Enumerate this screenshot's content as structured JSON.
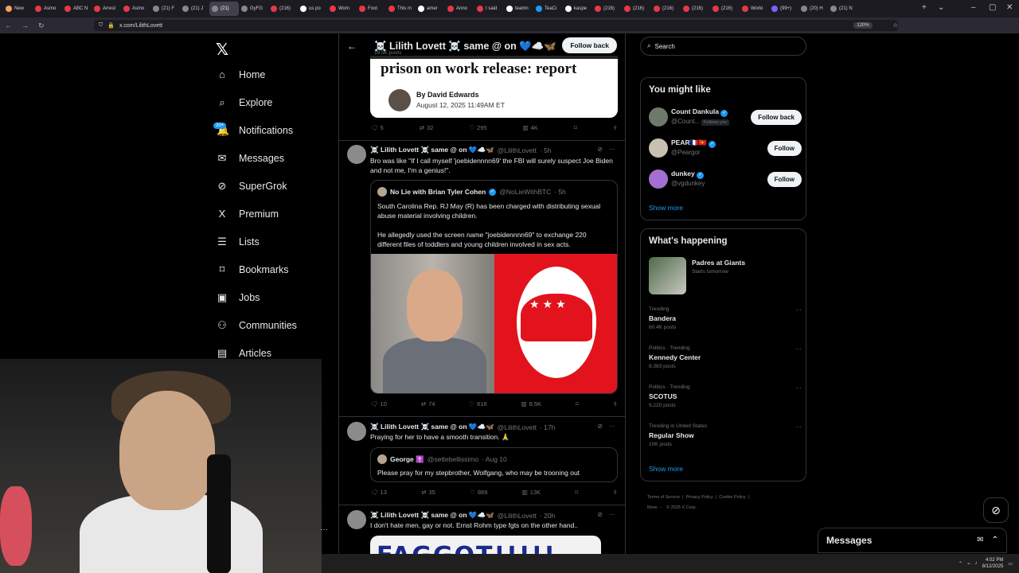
{
  "browser": {
    "tabs": [
      {
        "label": "New",
        "color": "#f4a261"
      },
      {
        "label": "Asmo",
        "color": "#e63946"
      },
      {
        "label": "ABC N",
        "color": "#e63946"
      },
      {
        "label": "Arrest",
        "color": "#e63946"
      },
      {
        "label": "Asmo",
        "color": "#e63946"
      },
      {
        "label": "(21) F",
        "color": "#888888"
      },
      {
        "label": "(21) J",
        "color": "#888888"
      },
      {
        "label": "(21)",
        "color": "#888888"
      },
      {
        "label": "GyFG",
        "color": "#888888"
      },
      {
        "label": "(216)",
        "color": "#e63946"
      },
      {
        "label": "us po",
        "color": "#ffffff"
      },
      {
        "label": "Wom",
        "color": "#e63946"
      },
      {
        "label": "Foot",
        "color": "#e63946"
      },
      {
        "label": "This m",
        "color": "#e63946"
      },
      {
        "label": "amer",
        "color": "#ffffff"
      },
      {
        "label": "Anno",
        "color": "#e63946"
      },
      {
        "label": "I said",
        "color": "#e63946"
      },
      {
        "label": "teamn",
        "color": "#ffffff"
      },
      {
        "label": "TeaCi",
        "color": "#1d9bf0"
      },
      {
        "label": "kaspe",
        "color": "#ffffff"
      },
      {
        "label": "(216)",
        "color": "#e63946"
      },
      {
        "label": "(216)",
        "color": "#e63946"
      },
      {
        "label": "(216)",
        "color": "#e63946"
      },
      {
        "label": "(216)",
        "color": "#e63946"
      },
      {
        "label": "(216)",
        "color": "#e63946"
      },
      {
        "label": "Worki",
        "color": "#e63946"
      },
      {
        "label": "(99+)",
        "color": "#7b61ff"
      },
      {
        "label": "(20) H",
        "color": "#888888"
      },
      {
        "label": "(21) N",
        "color": "#888888"
      }
    ],
    "active_tab_index": 7,
    "url": "x.com/LilithLovett",
    "zoom": "120%"
  },
  "nav": {
    "items": [
      {
        "label": "Home",
        "icon": "home-icon",
        "glyph": "⌂"
      },
      {
        "label": "Explore",
        "icon": "search-icon",
        "glyph": "⌕"
      },
      {
        "label": "Notifications",
        "icon": "bell-icon",
        "glyph": "🔔"
      },
      {
        "label": "Messages",
        "icon": "mail-icon",
        "glyph": "✉"
      },
      {
        "label": "SuperGrok",
        "icon": "grok-icon",
        "glyph": "⊘"
      },
      {
        "label": "Premium",
        "icon": "x-icon",
        "glyph": "X"
      },
      {
        "label": "Lists",
        "icon": "list-icon",
        "glyph": "☰"
      },
      {
        "label": "Bookmarks",
        "icon": "bookmark-icon",
        "glyph": "⌑"
      },
      {
        "label": "Jobs",
        "icon": "briefcase-icon",
        "glyph": "▣"
      },
      {
        "label": "Communities",
        "icon": "people-icon",
        "glyph": "⚇"
      },
      {
        "label": "Articles",
        "icon": "article-icon",
        "glyph": "▤"
      }
    ],
    "notifications_badge": "20+"
  },
  "profile": {
    "name": "☠️ Lilith Lovett ☠️ same @ on 💙☁️🦋",
    "posts": "19.5K posts",
    "follow_back": "Follow back"
  },
  "article_card": {
    "headline": "prison on work release: report",
    "byline": "By David Edwards",
    "date": "August 12, 2025 11:49AM ET"
  },
  "post0_actions": {
    "replies": "5",
    "reposts": "32",
    "likes": "295",
    "views": "4K"
  },
  "post1": {
    "name": "☠️ Lilith Lovett ☠️ same @ on 💙☁️🦋",
    "handle": "@LilithLovett",
    "time": "· 5h",
    "text": "Bro was like \"If I call myself 'joebidennnn69' the FBI will surely suspect Joe Biden and not me, I'm a genius!\".",
    "quote": {
      "name": "No Lie with Brian Tyler Cohen",
      "handle": "@NoLieWithBTC",
      "time": "· 5h",
      "text1": "South Carolina Rep. RJ May (R) has been charged with distributing sexual abuse material involving children.",
      "text2": "He allegedly used the screen name \"joebidennnn69\" to exchange 220 different files of toddlers and young children involved in sex acts."
    },
    "actions": {
      "replies": "10",
      "reposts": "74",
      "likes": "618",
      "views": "8.5K"
    }
  },
  "post2": {
    "name": "☠️ Lilith Lovett ☠️ same @ on 💙☁️🦋",
    "handle": "@LilithLovett",
    "time": "· 17h",
    "text": "Praying for her to have a smooth transition. 🙏",
    "quote": {
      "name": "George ✝️",
      "handle": "@settebellissimo",
      "time": "· Aug 10",
      "text": "Please pray for my stepbrother, Wolfgang, who may be trooning out"
    },
    "actions": {
      "replies": "13",
      "reposts": "35",
      "likes": "889",
      "views": "13K"
    }
  },
  "post3": {
    "name": "☠️ Lilith Lovett ☠️ same @ on 💙☁️🦋",
    "handle": "@LilithLovett",
    "time": "· 20h",
    "text": "I don't hate men, gay or not. Ernst Rohm type fgts on the other hand..",
    "image_text": "FAGGOT!!!!!"
  },
  "search": {
    "placeholder": "Search"
  },
  "suggestions": {
    "title": "You might like",
    "users": [
      {
        "name": "Count Dankula",
        "handle": "@Count...",
        "follows_you": "Follows you",
        "button": "Follow back"
      },
      {
        "name": "PEAR🇫🇷🇻🇳",
        "handle": "@Peargor",
        "follows_you": "",
        "button": "Follow"
      },
      {
        "name": "dunkey",
        "handle": "@vgdunkey",
        "follows_you": "",
        "button": "Follow"
      }
    ],
    "show_more": "Show more"
  },
  "happening": {
    "title": "What's happening",
    "featured": {
      "name": "Padres at Giants",
      "sub": "Starts tomorrow"
    },
    "trends": [
      {
        "category": "Trending",
        "name": "Bandera",
        "posts": "60.4K posts"
      },
      {
        "category": "Politics · Trending",
        "name": "Kennedy Center",
        "posts": "8,383 posts"
      },
      {
        "category": "Politics · Trending",
        "name": "SCOTUS",
        "posts": "9,220 posts"
      },
      {
        "category": "Trending in United States",
        "name": "Regular Show",
        "posts": "10K posts"
      }
    ],
    "show_more": "Show more"
  },
  "footer": {
    "terms": "Terms of Service",
    "privacy": "Privacy Policy",
    "cookie": "Cookie Policy",
    "more": "More ···",
    "copyright": "© 2025 X Corp."
  },
  "messages_dock": {
    "label": "Messages"
  },
  "taskbar": {
    "time": "4:02 PM",
    "date": "8/12/2025"
  }
}
